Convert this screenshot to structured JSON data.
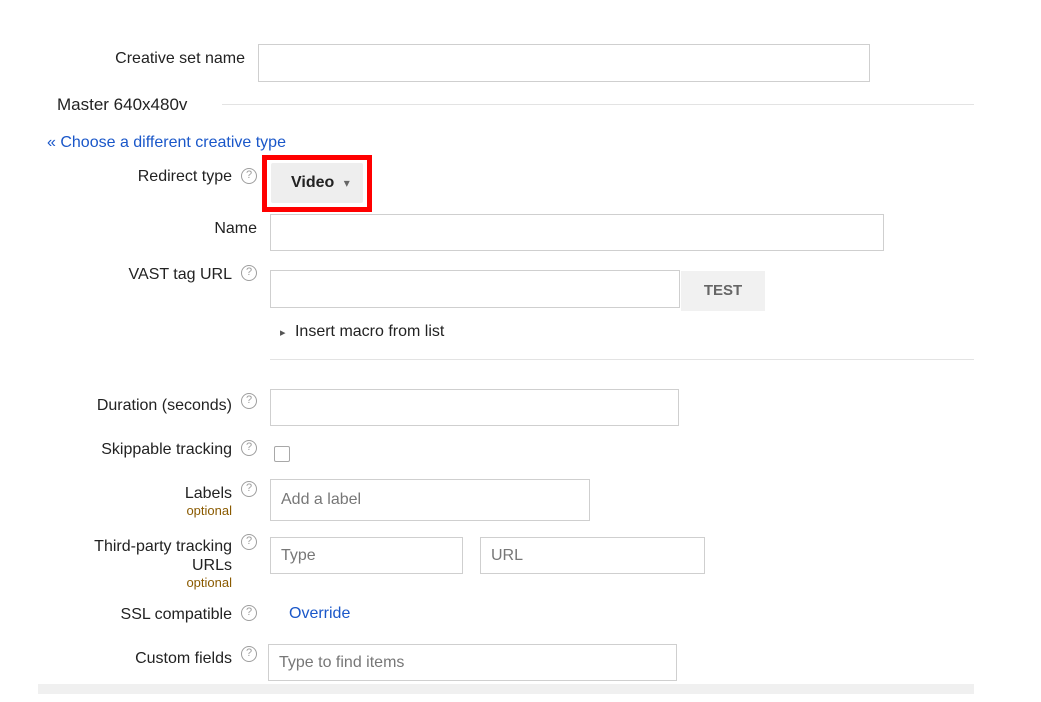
{
  "creative_set": {
    "label": "Creative set name",
    "value": ""
  },
  "section": {
    "title": "Master 640x480v"
  },
  "choose_type_link": "« Choose a different creative type",
  "redirect_type": {
    "label": "Redirect type",
    "selected": "Video",
    "highlight_color": "#ff0000"
  },
  "name_field": {
    "label": "Name",
    "value": ""
  },
  "vast": {
    "label": "VAST tag URL",
    "value": "",
    "test_label": "TEST",
    "macro_label": "Insert macro from list"
  },
  "duration": {
    "label": "Duration (seconds)",
    "value": ""
  },
  "skippable": {
    "label": "Skippable tracking",
    "checked": false
  },
  "labels_field": {
    "label": "Labels",
    "optional": "optional",
    "placeholder": "Add a label"
  },
  "tracking": {
    "label_line1": "Third-party tracking",
    "label_line2": "URLs",
    "optional": "optional",
    "type_placeholder": "Type",
    "url_placeholder": "URL"
  },
  "ssl": {
    "label": "SSL compatible",
    "override_label": "Override"
  },
  "custom_fields": {
    "label": "Custom fields",
    "placeholder": "Type to find items"
  },
  "icons": {
    "help": "help-circle-icon",
    "help_glyph": "?",
    "dropdown": "triangle-down-icon",
    "dropdown_glyph": "▾",
    "expand": "triangle-right-icon",
    "expand_glyph": "▸"
  },
  "colors": {
    "link": "#1a57c9",
    "optional": "#8a5a00",
    "highlight": "#ff0000"
  }
}
